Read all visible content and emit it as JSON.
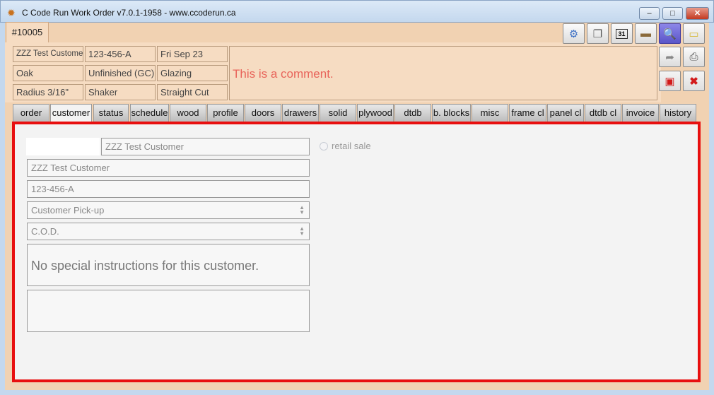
{
  "window": {
    "title": "C Code Run Work Order v7.0.1-1958 - www.ccoderun.ca",
    "minimize": "–",
    "maximize": "□",
    "close": "✕"
  },
  "order_tab": "#10005",
  "header": {
    "customer": "ZZZ Test Customer",
    "order_number": "123-456-A",
    "date": "Fri Sep 23",
    "wood": "Oak",
    "finish": "Unfinished (GC)",
    "glazing": "Glazing",
    "radius": "Radius 3/16\"",
    "style": "Shaker",
    "cut": "Straight Cut",
    "comment": "This is a comment."
  },
  "toolbar_icons": [
    "gear-icon",
    "chat-icon",
    "calendar-icon",
    "folder-icon",
    "search-document-icon",
    "notepad-icon",
    "export-icon",
    "print-icon",
    "save-icon",
    "close-icon"
  ],
  "tabs": [
    "order",
    "customer",
    "status",
    "schedule",
    "wood",
    "profile",
    "doors",
    "drawers",
    "solid",
    "plywood",
    "dtdb",
    "b. blocks",
    "misc",
    "frame cl",
    "panel cl",
    "dtdb cl",
    "invoice",
    "history"
  ],
  "selected_tab": "customer",
  "customer_tab": {
    "search_value": "ZZZ Test Customer",
    "retail_label": "retail sale",
    "customer_name": "ZZZ Test Customer",
    "po_number": "123-456-A",
    "delivery": "Customer Pick-up",
    "payment": "C.O.D.",
    "special_instructions": "No special instructions for this customer.",
    "notes": ""
  },
  "colors": {
    "accent_border": "#e80f0f",
    "comment_text": "#e8645a",
    "header_bg": "#f6dcc2"
  }
}
